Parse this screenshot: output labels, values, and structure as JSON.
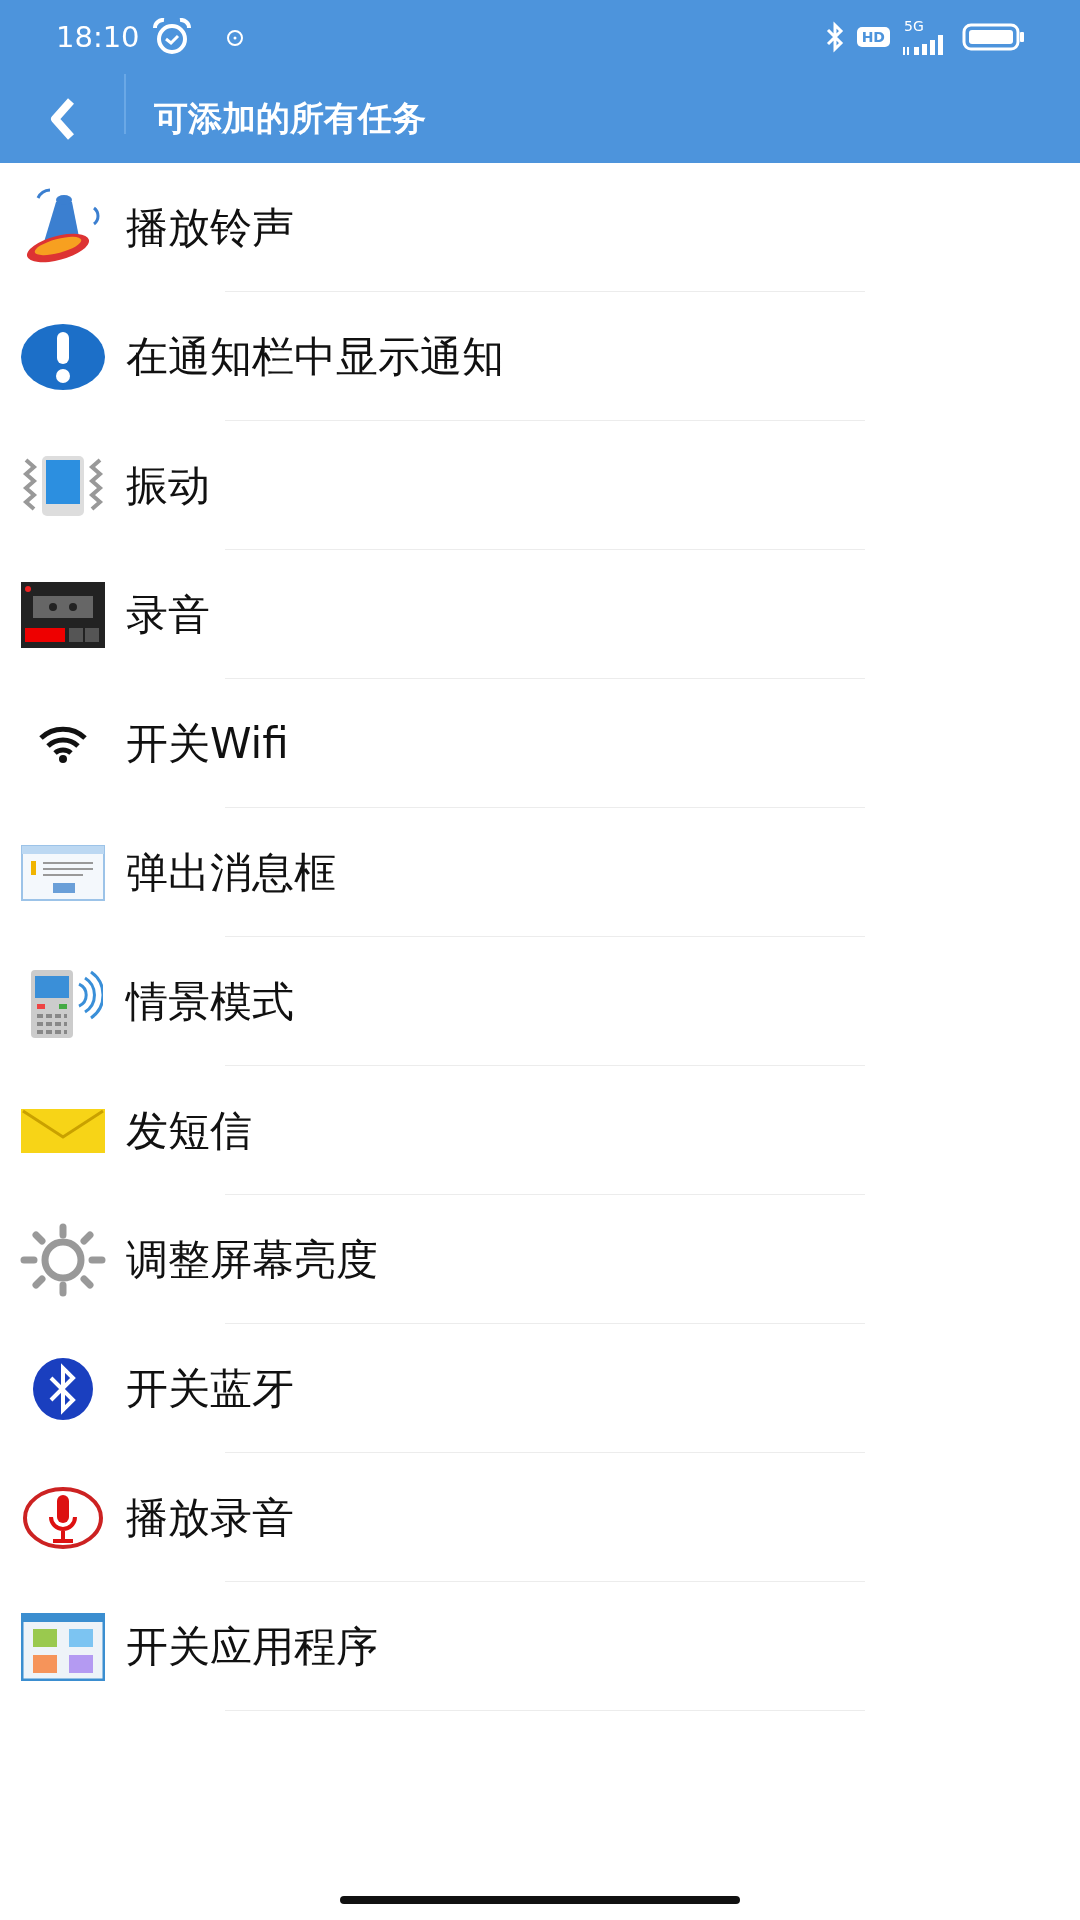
{
  "status_bar": {
    "time": "18:10",
    "hd": "HD",
    "network": "5G"
  },
  "header": {
    "title": "可添加的所有任务"
  },
  "tasks": [
    {
      "label": "播放铃声",
      "kind": "bell"
    },
    {
      "label": "在通知栏中显示通知",
      "kind": "notice"
    },
    {
      "label": "振动",
      "kind": "vibrate"
    },
    {
      "label": "录音",
      "kind": "recorder"
    },
    {
      "label": "开关Wifi",
      "kind": "wifi"
    },
    {
      "label": "弹出消息框",
      "kind": "dialog"
    },
    {
      "label": "情景模式",
      "kind": "phone"
    },
    {
      "label": "发短信",
      "kind": "mail"
    },
    {
      "label": "调整屏幕亮度",
      "kind": "brightness"
    },
    {
      "label": "开关蓝牙",
      "kind": "bluetooth"
    },
    {
      "label": "播放录音",
      "kind": "mic"
    },
    {
      "label": "开关应用程序",
      "kind": "apps"
    }
  ]
}
